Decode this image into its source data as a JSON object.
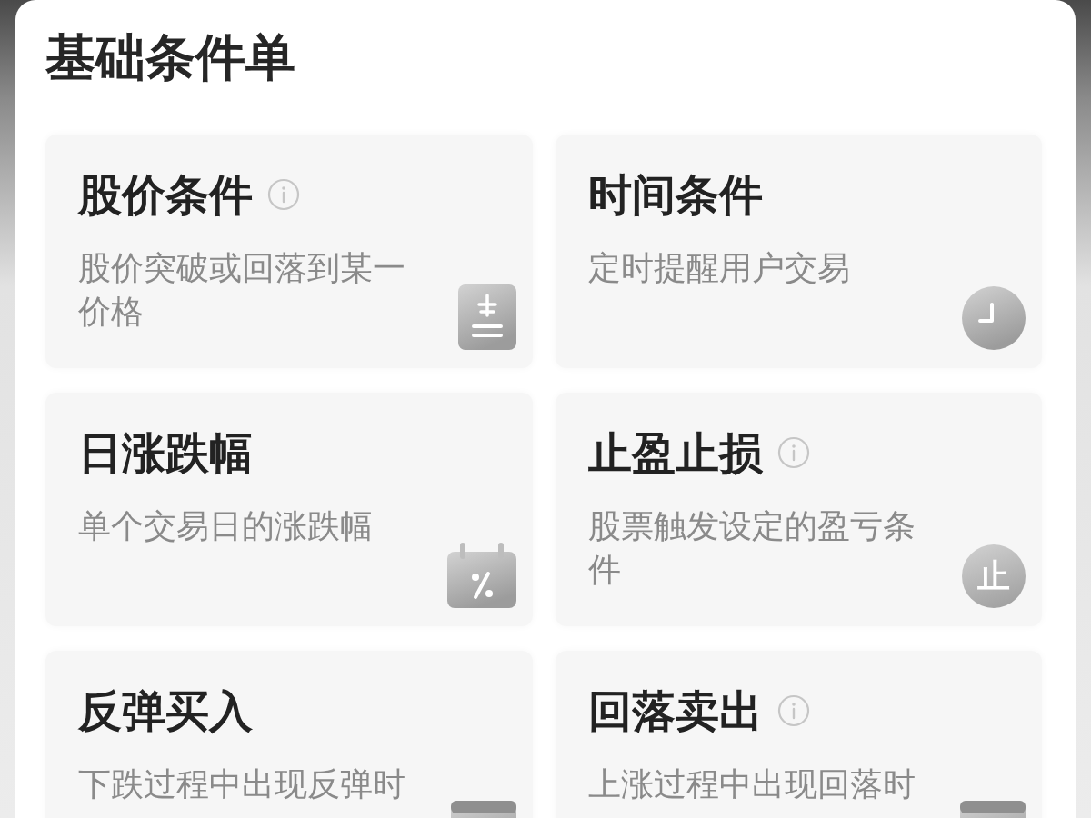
{
  "panel": {
    "title": "基础条件单"
  },
  "cards": [
    {
      "title": "股价条件",
      "info": true,
      "description": "股价突破或回落到某一价格",
      "icon": {
        "kind": "price"
      }
    },
    {
      "title": "时间条件",
      "info": false,
      "description": "定时提醒用户交易",
      "icon": {
        "kind": "clock"
      }
    },
    {
      "title": "日涨跌幅",
      "info": false,
      "description": "单个交易日的涨跌幅",
      "icon": {
        "kind": "calendar"
      }
    },
    {
      "title": "止盈止损",
      "info": true,
      "description": "股票触发设定的盈亏条件",
      "icon": {
        "kind": "glyph",
        "glyph": "止"
      }
    },
    {
      "title": "反弹买入",
      "info": false,
      "description": "下跌过程中出现反弹时",
      "icon": {
        "kind": "tile"
      }
    },
    {
      "title": "回落卖出",
      "info": true,
      "description": "上涨过程中出现回落时",
      "icon": {
        "kind": "tile"
      }
    }
  ]
}
